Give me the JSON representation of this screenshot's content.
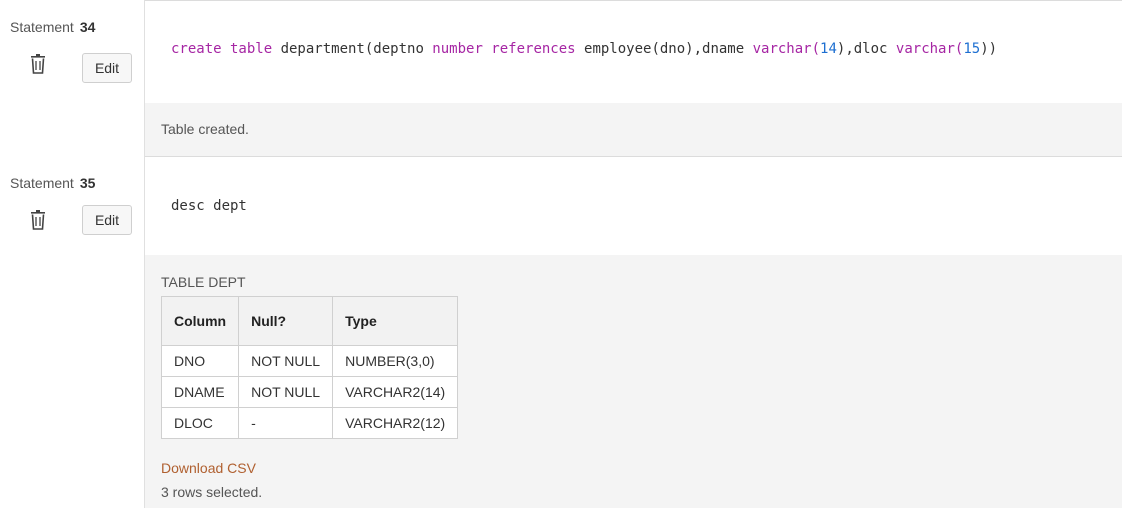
{
  "statements": [
    {
      "label": "Statement",
      "number": "34",
      "edit_label": "Edit",
      "code_tokens": [
        {
          "t": "create table ",
          "k": "kw"
        },
        {
          "t": "department(deptno ",
          "k": ""
        },
        {
          "t": "number references ",
          "k": "kw"
        },
        {
          "t": "employee(dno),dname ",
          "k": ""
        },
        {
          "t": "varchar(",
          "k": "kw"
        },
        {
          "t": "14",
          "k": "num"
        },
        {
          "t": "),dloc ",
          "k": ""
        },
        {
          "t": "varchar(",
          "k": "kw"
        },
        {
          "t": "15",
          "k": "num"
        },
        {
          "t": "))",
          "k": ""
        }
      ],
      "result": "Table created."
    },
    {
      "label": "Statement",
      "number": "35",
      "edit_label": "Edit",
      "code": "desc dept",
      "result_title": "TABLE DEPT",
      "table": {
        "headers": [
          "Column",
          "Null?",
          "Type"
        ],
        "rows": [
          [
            "DNO",
            "NOT NULL",
            "NUMBER(3,0)"
          ],
          [
            "DNAME",
            "NOT NULL",
            "VARCHAR2(14)"
          ],
          [
            "DLOC",
            "-",
            "VARCHAR2(12)"
          ]
        ]
      },
      "download_label": "Download CSV",
      "rows_selected": "3 rows selected."
    }
  ],
  "colors": {
    "keyword": "#a626a4",
    "number": "#1d6fd1",
    "link": "#b06030",
    "result_bg": "#f4f4f4"
  },
  "icons": {
    "delete": "trash-icon"
  }
}
